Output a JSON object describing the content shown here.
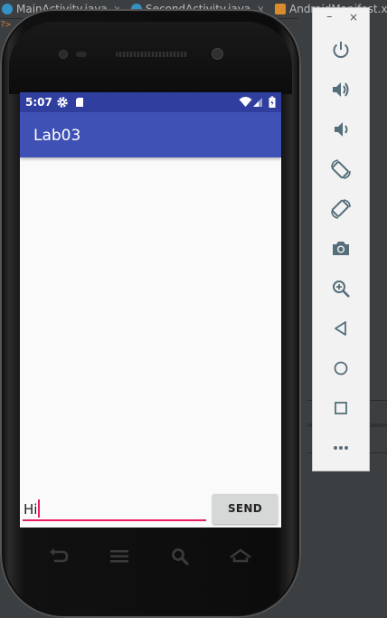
{
  "ide": {
    "tabs": [
      {
        "label": "MainActivity.java",
        "icon": "java-class-icon"
      },
      {
        "label": "SecondActivity.java",
        "icon": "java-class-icon"
      },
      {
        "label": "AndroidManifest.xml",
        "icon": "xml-file-icon"
      }
    ],
    "gutter_text": "?>"
  },
  "device": {
    "status_bar": {
      "time": "5:07",
      "icons": [
        "settings-icon",
        "sd-card-icon",
        "wifi-icon",
        "signal-icon",
        "battery-charging-icon"
      ]
    },
    "app": {
      "title": "Lab03"
    },
    "composer": {
      "input_value": "Hi",
      "send_label": "SEND"
    },
    "hardware_buttons": [
      "back-icon",
      "menu-icon",
      "search-icon",
      "home-icon"
    ]
  },
  "emulator_toolbar": {
    "window_controls": {
      "minimize": "–",
      "close": "×"
    },
    "buttons": [
      "power-icon",
      "volume-up-icon",
      "volume-down-icon",
      "rotate-left-icon",
      "rotate-right-icon",
      "camera-icon",
      "zoom-icon",
      "back-triangle-icon",
      "home-circle-icon",
      "overview-square-icon",
      "more-icon"
    ]
  },
  "colors": {
    "primary": "#3f51b5",
    "primary_dark": "#303f9f",
    "accent": "#e91e63"
  }
}
